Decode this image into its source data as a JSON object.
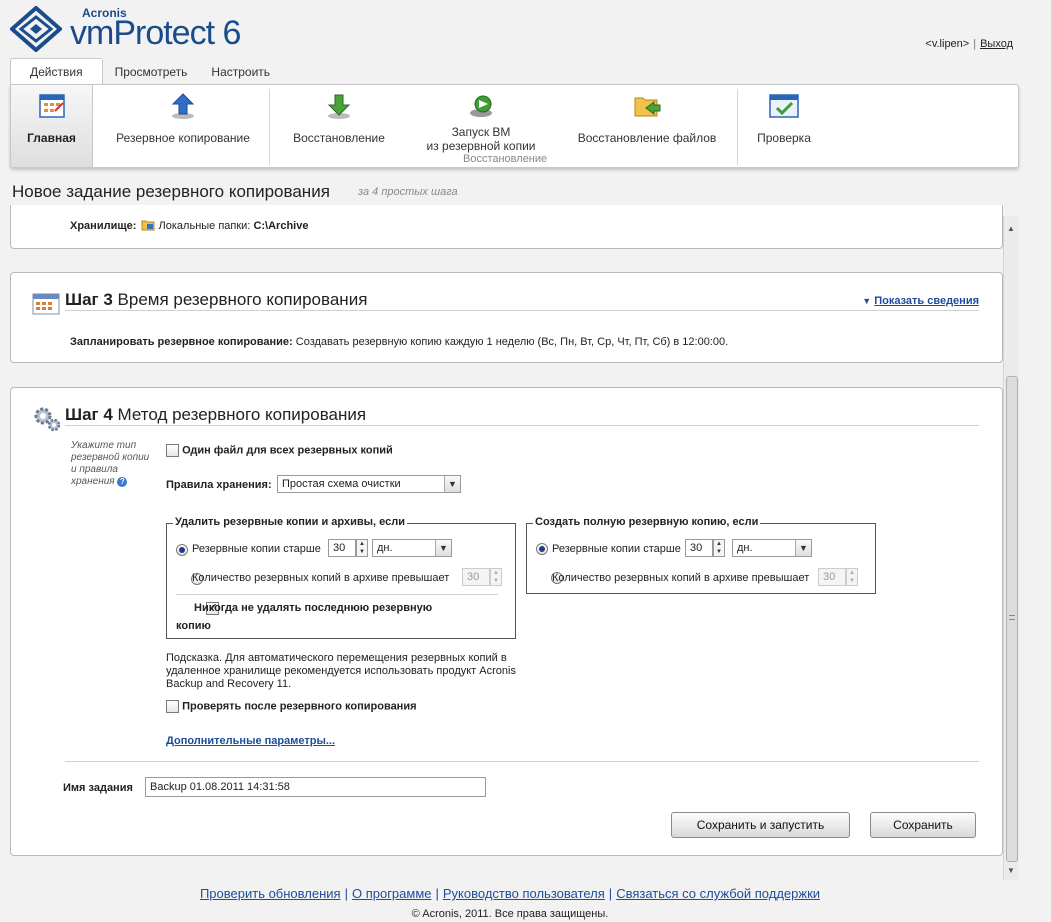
{
  "app": {
    "brand": "Acronis",
    "product_name": "vmProtect",
    "product_version": "6",
    "accent_color": "#1d4d9e"
  },
  "user": {
    "username": "<v.lipen>",
    "logout_label": "Выход"
  },
  "tabs": [
    {
      "label": "Действия",
      "active": true
    },
    {
      "label": "Просмотреть",
      "active": false
    },
    {
      "label": "Настроить",
      "active": false
    }
  ],
  "ribbon": {
    "buttons": [
      {
        "label": "Главная",
        "icon": "calendar-home-icon",
        "active": true
      },
      {
        "label": "Резервное копирование",
        "icon": "backup-arrow-up-icon"
      },
      {
        "label": "Восстановление",
        "icon": "restore-arrow-down-icon"
      },
      {
        "label_line1": "Запуск ВМ",
        "label_line2": "из резервной копии",
        "icon": "run-vm-icon"
      },
      {
        "label": "Восстановление файлов",
        "icon": "folder-restore-icon"
      },
      {
        "label": "Проверка",
        "icon": "validate-check-icon"
      }
    ],
    "group_label": "Восстановление"
  },
  "page": {
    "title": "Новое задание резервного копирования",
    "subtitle": "за 4 простых шага"
  },
  "step2_tail": {
    "storage_label": "Хранилище:",
    "storage_type": "Локальные папки:",
    "storage_path": "C:\\Archive"
  },
  "step3": {
    "number": "Шаг 3",
    "title": "Время резервного копирования",
    "details_link": "Показать сведения",
    "schedule_label": "Запланировать резервное копирование:",
    "schedule_value": "Создавать резервную копию каждую 1 неделю (Вс, Пн, Вт, Ср, Чт, Пт, Сб) в 12:00:00."
  },
  "step4": {
    "number": "Шаг 4",
    "title": "Метод резервного копирования",
    "help_text": [
      "Укажите тип",
      "резервной копии",
      "и правила",
      "хранения"
    ],
    "single_file_label": "Один файл для всех резервных копий",
    "single_file_checked": false,
    "retention_label": "Правила хранения:",
    "retention_value": "Простая схема очистки",
    "delete_group": {
      "legend": "Удалить резервные копии и архивы, если",
      "older_label": "Резервные копии старше",
      "older_checked": true,
      "older_value": "30",
      "older_unit": "дн.",
      "count_label": "Количество резервных копий в архиве превышает",
      "count_checked": false,
      "count_value": "30",
      "never_delete_line1": "Никогда не удалять последнюю резервную",
      "never_delete_line2": "копию",
      "never_delete_checked": true
    },
    "full_group": {
      "legend": "Создать полную резервную копию, если",
      "older_label": "Резервные копии старше",
      "older_checked": true,
      "older_value": "30",
      "older_unit": "дн.",
      "count_label": "Количество резервных копий в архиве превышает",
      "count_checked": false,
      "count_value": "30"
    },
    "hint_lines": [
      "Подсказка. Для автоматического перемещения резервных копий в",
      "удаленное хранилище рекомендуется использовать продукт Acronis",
      "Backup and Recovery 11."
    ],
    "validate_label": "Проверять после резервного копирования",
    "validate_checked": false,
    "advanced_link": "Дополнительные параметры..."
  },
  "task": {
    "name_label": "Имя задания",
    "name_value": "Backup 01.08.2011 14:31:58",
    "save_run_label": "Сохранить и запустить",
    "save_label": "Сохранить"
  },
  "footer": {
    "links": [
      "Проверить обновления",
      "О программе",
      "Руководство пользователя",
      "Связаться со службой поддержки"
    ],
    "separator": "|",
    "copyright": "© Acronis, 2011. Все права защищены."
  }
}
